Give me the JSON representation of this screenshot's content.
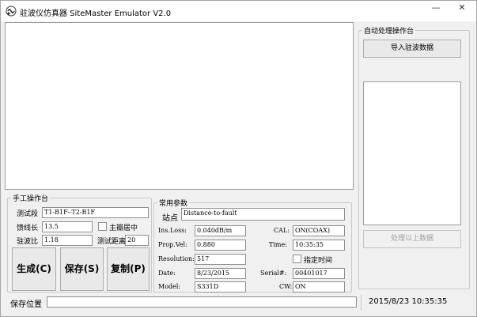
{
  "window": {
    "title": "驻波仪仿真器 SiteMaster Emulator V2.0",
    "minimize_glyph": "—",
    "close_glyph": "✕"
  },
  "auto": {
    "group_title": "自动处理操作台",
    "import_label": "导入驻波数据",
    "process_label": "处理以上数据"
  },
  "manual": {
    "group_title": "手工操作台",
    "segment_label": "测试段",
    "segment_value": "T1-B1F--T2-B1F",
    "cable_length_label": "馈线长",
    "cable_length_value": "13.5",
    "wave_ratio_label": "驻波比",
    "wave_ratio_value": "1.18",
    "center_peak_label": "主瓣居中",
    "test_distance_label": "测试距离",
    "test_distance_value": "20",
    "generate_label": "生成(C)",
    "save_label": "保存(S)",
    "copy_label": "复制(P)"
  },
  "params": {
    "group_title": "常用参数",
    "site_label": "站点",
    "site_value": "Distance-to-fault",
    "ins_loss_label": "Ins.Loss:",
    "ins_loss_value": "0.040dB/m",
    "cal_label": "CAL:",
    "cal_value": "ON(COAX)",
    "prop_vel_label": "Prop.Vel:",
    "prop_vel_value": "0.880",
    "time_label": "Time:",
    "time_value": "10:35:35",
    "resolution_label": "Resolution:",
    "resolution_value": "517",
    "specify_time_label": "指定时间",
    "date_label": "Date:",
    "date_value": "8/23/2015",
    "serial_label": "Serial#:",
    "serial_value": "00401017",
    "model_label": "Model:",
    "model_value": "S331D",
    "cw_label": "CW:",
    "cw_value": "ON"
  },
  "status": {
    "save_location_label": "保存位置",
    "datetime": "2015/8/23 10:35:35"
  },
  "colors": {
    "window_bg": "#f0f0f0",
    "panel_white": "#ffffff",
    "disabled_text": "#a0a0a0"
  }
}
